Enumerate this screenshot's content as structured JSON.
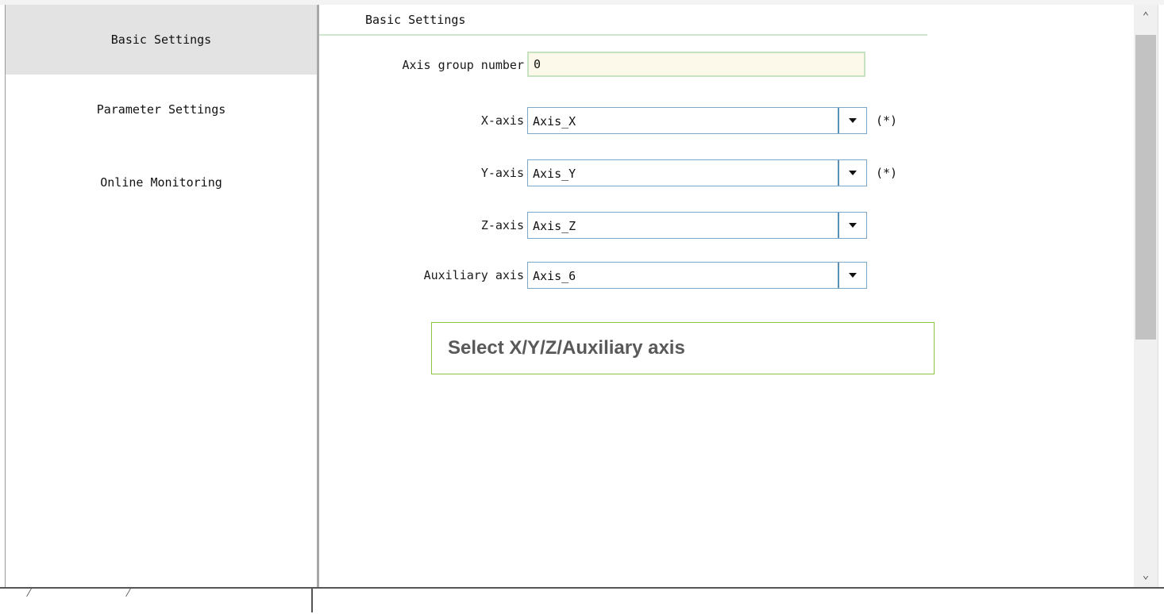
{
  "sidebar": {
    "items": [
      {
        "label": "Basic Settings",
        "active": true
      },
      {
        "label": "Parameter Settings",
        "active": false
      },
      {
        "label": "Online Monitoring",
        "active": false
      }
    ]
  },
  "main": {
    "section_title": "Basic Settings",
    "fields": {
      "axis_group": {
        "label": "Axis group number",
        "value": "0"
      },
      "x_axis": {
        "label": "X-axis",
        "value": "Axis_X",
        "required": "(*)"
      },
      "y_axis": {
        "label": "Y-axis",
        "value": "Axis_Y",
        "required": "(*)"
      },
      "z_axis": {
        "label": "Z-axis",
        "value": "Axis_Z"
      },
      "aux_axis": {
        "label": "Auxiliary axis",
        "value": "Axis_6"
      }
    }
  },
  "callout": {
    "text": "Select X/Y/Z/Auxiliary axis"
  },
  "scrollbar": {
    "up_icon": "chevron-up-icon",
    "down_icon": "chevron-down-icon"
  },
  "colors": {
    "active_item_bg": "#e3e3e3",
    "textbox_bg": "#fdf9ea",
    "textbox_border": "#c7e2c1",
    "combo_border": "#7aa7c7",
    "callout_border": "#8cc63f",
    "callout_text": "#595959"
  }
}
